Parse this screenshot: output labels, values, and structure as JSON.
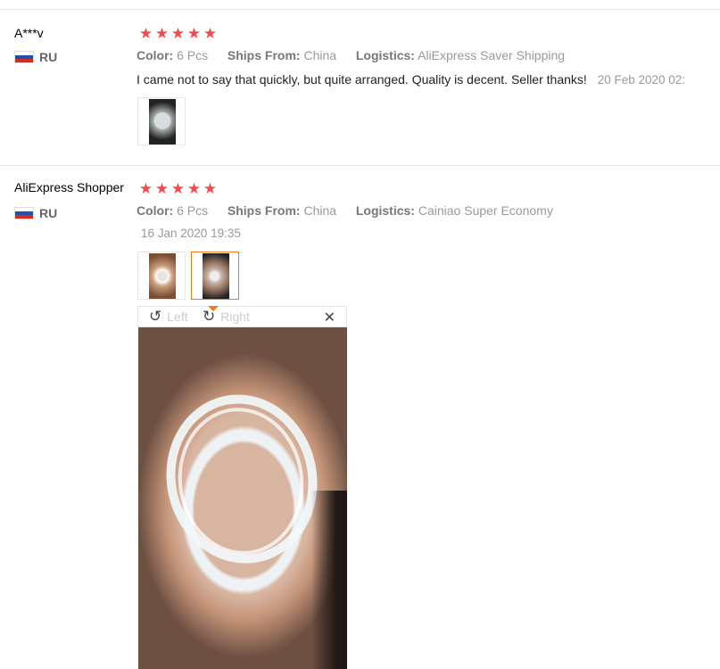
{
  "reviews": [
    {
      "user": "A***v",
      "country": "RU",
      "rating": 5,
      "color_label": "Color:",
      "color_value": "6 Pcs",
      "ships_label": "Ships From:",
      "ships_value": "China",
      "logistics_label": "Logistics:",
      "logistics_value": "AliExpress Saver Shipping",
      "feedback": "I came not to say that quickly, but quite arranged. Quality is decent. Seller thanks!",
      "date": "20 Feb 2020 02:"
    },
    {
      "user": "AliExpress Shopper",
      "country": "RU",
      "rating": 5,
      "color_label": "Color:",
      "color_value": "6 Pcs",
      "ships_label": "Ships From:",
      "ships_value": "China",
      "logistics_label": "Logistics:",
      "logistics_value": "Cainiao Super Economy",
      "date": "16 Jan 2020 19:35"
    }
  ],
  "viewer": {
    "rotate_left": "Left",
    "rotate_right": "Right",
    "close_icon": "close-icon"
  },
  "colors": {
    "star": "#f44a4a",
    "active_thumb": "#f07a1a"
  }
}
